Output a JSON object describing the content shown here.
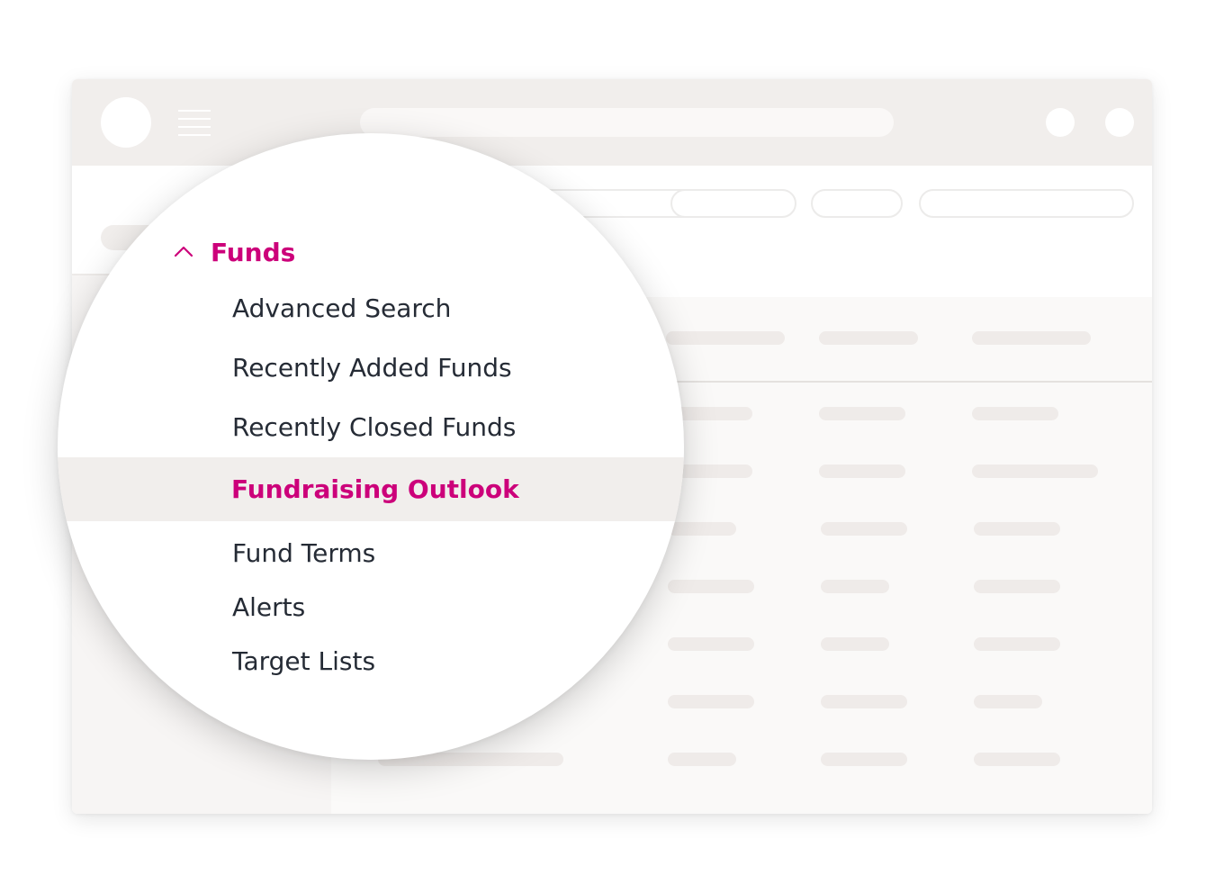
{
  "menu": {
    "section_title": "Funds",
    "section_icon": "chevron-up-icon",
    "items": [
      {
        "label": "Advanced Search"
      },
      {
        "label": "Recently Added Funds"
      },
      {
        "label": "Recently Closed Funds"
      },
      {
        "label": "Fundraising Outlook",
        "selected": true
      },
      {
        "label": "Fund Terms"
      },
      {
        "label": "Alerts"
      },
      {
        "label": "Target Lists"
      }
    ]
  },
  "icons": {
    "avatar": "avatar-placeholder",
    "hamburger": "hamburger-menu-icon"
  },
  "colors": {
    "accent": "#cc007a",
    "text": "#252b35",
    "chrome": "#f1eeec",
    "selected_row_bg": "#f1eeec",
    "placeholder_bar": "#efebe9"
  }
}
